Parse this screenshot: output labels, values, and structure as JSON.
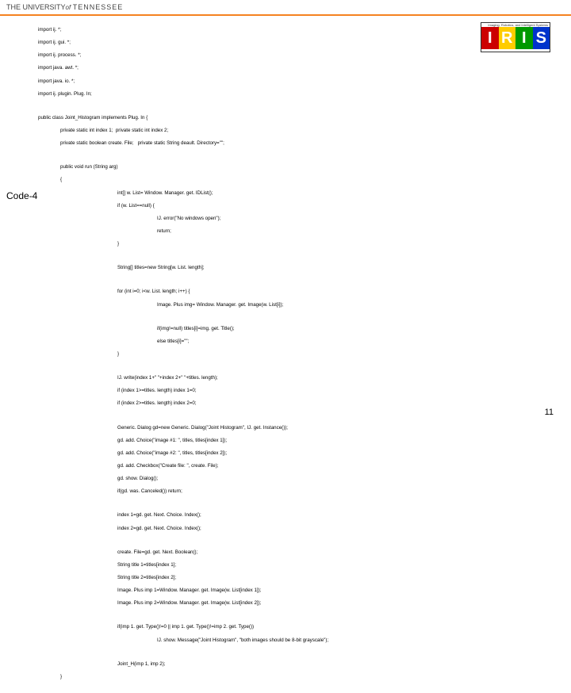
{
  "header": {
    "the": "THE",
    "univ": "UNIVERSITY",
    "of": "of",
    "tenn": "TENNESSEE"
  },
  "logo": {
    "caption": "Imaging, Robotics, and Intelligent Systems",
    "l1": "I",
    "l2": "R",
    "l3": "I",
    "l4": "S"
  },
  "sideLabel": "Code-4",
  "pageNum": "11",
  "code": {
    "l01": "import ij. *;",
    "l02": "import ij. gui. *;",
    "l03": "import ij. process. *;",
    "l04": "import java. awt. *;",
    "l05": "import java. io. *;",
    "l06": "import ij. plugin. Plug. In;",
    "l07": "public class Joint_Histogram implements Plug. In {",
    "l08": "private static int index 1;  private static int index 2;",
    "l09": "private static boolean create. File;   private static String deault. Directory=\"\";",
    "l10": "public void run (String arg)",
    "l11": "{",
    "l12": "int[] w. List= Window. Manager. get. IDList();",
    "l13": "if (w. List==null) {",
    "l14": "IJ. error(\"No windows open\");",
    "l15": "return;",
    "l16": "}",
    "l17": "String[] titles=new String[w. List. length];",
    "l18": "for (int i=0; i<w. List. length; i++) {",
    "l19": "Image. Plus img= Window. Manager. get. Image(w. List[i]);",
    "l20": "if(img!=null) titles[i]=img. get. Title();",
    "l21": "else titles[i]=\"\";",
    "l22": "}",
    "l23": "IJ. write(index 1+\" \"+index 2+\" \"+titles. length);",
    "l24": "if (index 1>=titles. length) index 1=0;",
    "l25": "if (index 2>=titles. length) index 2=0;",
    "l26": "Generic. Dialog gd=new Generic. Dialog(\"Joint Histogram\", IJ. get. Instance());",
    "l27": "gd. add. Choice(\"image #1: \", titles, titles[index 1]);",
    "l28": "gd. add. Choice(\"image #2: \", titles, titles[index 2]);",
    "l29": "gd. add. Checkbox(\"Create file: \", create. File);",
    "l30": "gd. show. Dialog();",
    "l31": "if(gd. was. Canceled()) return;",
    "l32": "index 1=gd. get. Next. Choice. Index();",
    "l33": "index 2=gd. get. Next. Choice. Index();",
    "l34": "create. File=gd. get. Next. Boolean();",
    "l35": "String title 1=titles[index 1];",
    "l36": "String title 2=titles[index 2];",
    "l37": "Image. Plus imp 1=Window. Manager. get. Image(w. List[index 1]);",
    "l38": "Image. Plus imp 2=Window. Manager. get. Image(w. List[index 2]);",
    "l39": "if(imp 1. get. Type()!=0 || imp 1. get. Type()!=imp 2. get. Type())",
    "l40": "IJ. show. Message(\"Joint Histogram\", \"both images should be 8-bit grayscale\");",
    "l41": "Joint_H(imp 1, imp 2);",
    "l42": "}"
  }
}
